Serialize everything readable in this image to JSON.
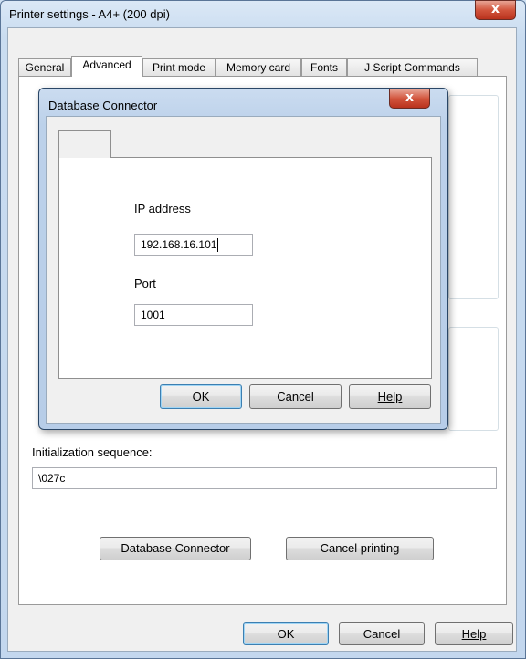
{
  "window": {
    "title": "Printer settings - A4+ (200 dpi)",
    "close_glyph": "x"
  },
  "tabs": [
    {
      "label": "General"
    },
    {
      "label": "Advanced",
      "active": true
    },
    {
      "label": "Print mode"
    },
    {
      "label": "Memory card"
    },
    {
      "label": "Fonts"
    },
    {
      "label": "J Script Commands"
    }
  ],
  "init_sequence": {
    "label": "Initialization sequence:",
    "value": "\\027c"
  },
  "buttons": {
    "database_connector": "Database Connector",
    "cancel_printing": "Cancel printing",
    "ok": "OK",
    "cancel": "Cancel",
    "help": "Help"
  },
  "dialog": {
    "title": "Database Connector",
    "close_glyph": "x",
    "tab_label": "",
    "ip_label": "IP address",
    "ip_value": "192.168.16.101",
    "port_label": "Port",
    "port_value": "1001",
    "buttons": {
      "ok": "OK",
      "cancel": "Cancel",
      "help": "Help"
    }
  },
  "colors": {
    "close_red": "#c9462d",
    "window_frame": "#c3d7ee",
    "focus_blue": "#3c7fb1"
  },
  "icons": {
    "close": "close-icon"
  }
}
